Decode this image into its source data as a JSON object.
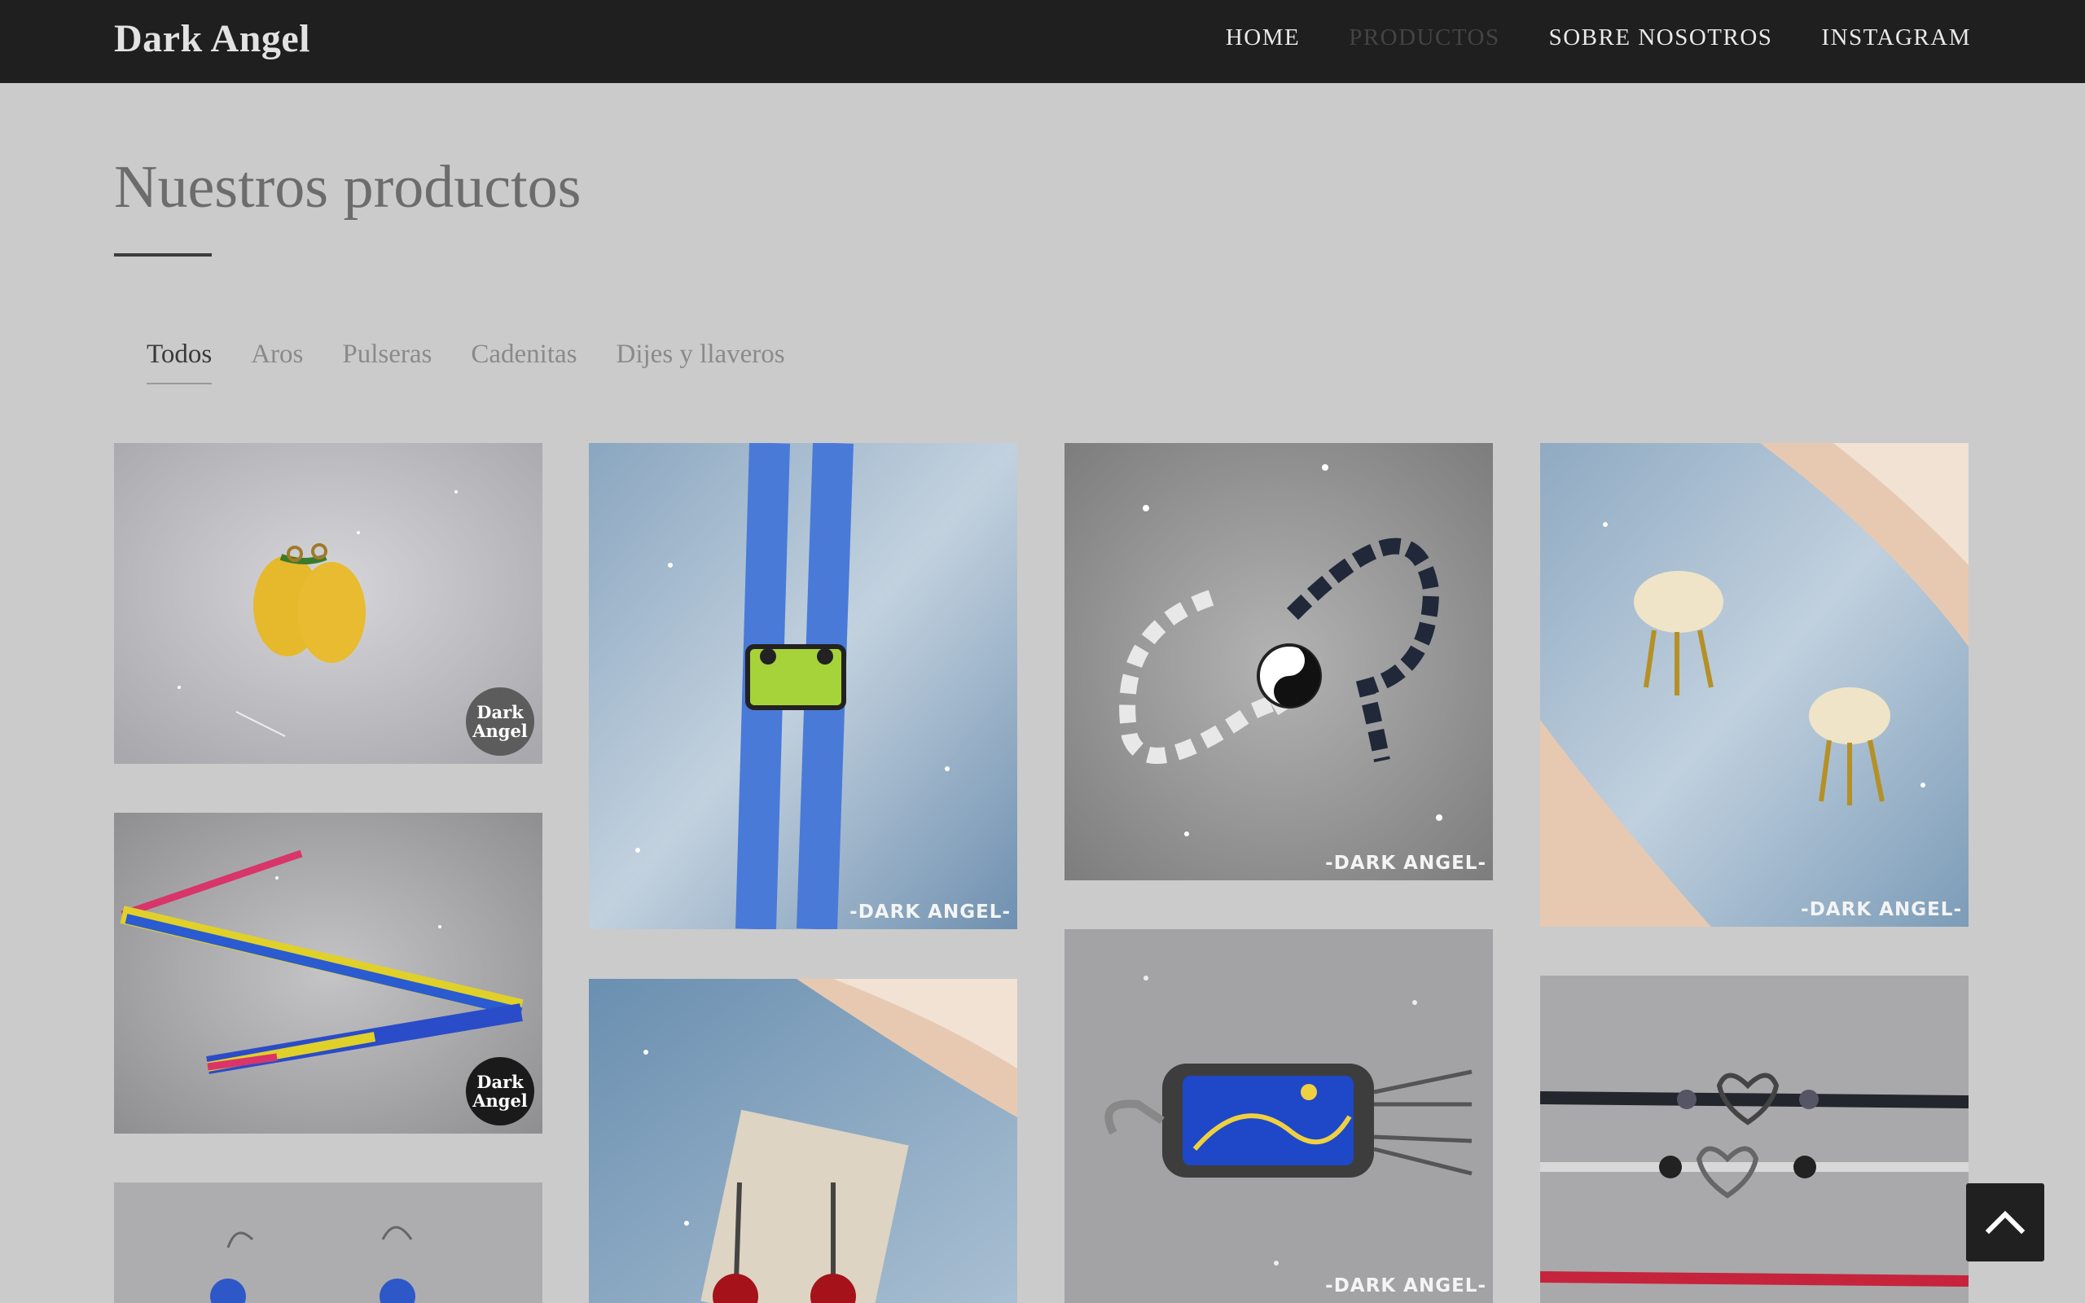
{
  "brand": "Dark Angel",
  "nav": {
    "home": "HOME",
    "productos": "PRODUCTOS",
    "sobre": "SOBRE NOSOTROS",
    "instagram": "INSTAGRAM"
  },
  "page": {
    "title": "Nuestros productos"
  },
  "filters": {
    "todos": "Todos",
    "aros": "Aros",
    "pulseras": "Pulseras",
    "cadenitas": "Cadenitas",
    "dijes": "Dijes y llaveros"
  },
  "products": [
    {
      "category": "Aros",
      "watermark": "Dark Angel"
    },
    {
      "category": "Pulseras",
      "watermark": "Dark Angel"
    },
    {
      "category": "Aros",
      "watermark": ""
    },
    {
      "category": "Pulseras",
      "watermark": "-DARK ANGEL-"
    },
    {
      "category": "Aros",
      "watermark": ""
    },
    {
      "category": "Dijes y llaveros",
      "watermark": "-DARK ANGEL-"
    },
    {
      "category": "Dijes y llaveros",
      "watermark": "-DARK ANGEL-"
    },
    {
      "category": "Aros",
      "watermark": "-DARK ANGEL-"
    },
    {
      "category": "Cadenitas",
      "watermark": ""
    }
  ],
  "icons": {
    "scroll_top": "chevron-up-icon"
  },
  "colors": {
    "navbar": "#1f1f1f",
    "background": "#cbcbcb",
    "accent_nav_active": "#444444"
  }
}
